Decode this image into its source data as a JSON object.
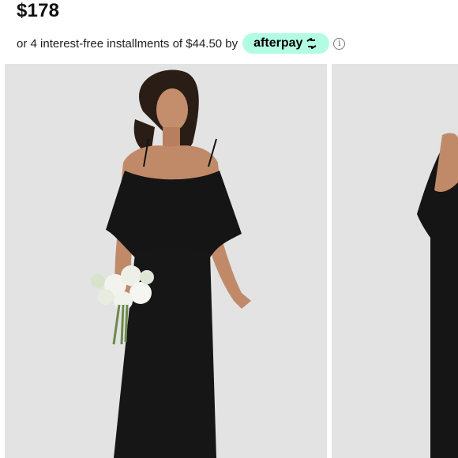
{
  "product": {
    "price": "$178",
    "installments_text": "or 4 interest-free installments of $44.50 by",
    "afterpay_label": "afterpay",
    "info_icon": "info-icon"
  },
  "gallery": {
    "images": [
      {
        "alt": "main-product-photo"
      },
      {
        "alt": "next-product-photo"
      }
    ]
  },
  "colors": {
    "afterpay_mint": "#b2fce4",
    "photo_background": "#e3e3e3",
    "dress": "#151515"
  }
}
